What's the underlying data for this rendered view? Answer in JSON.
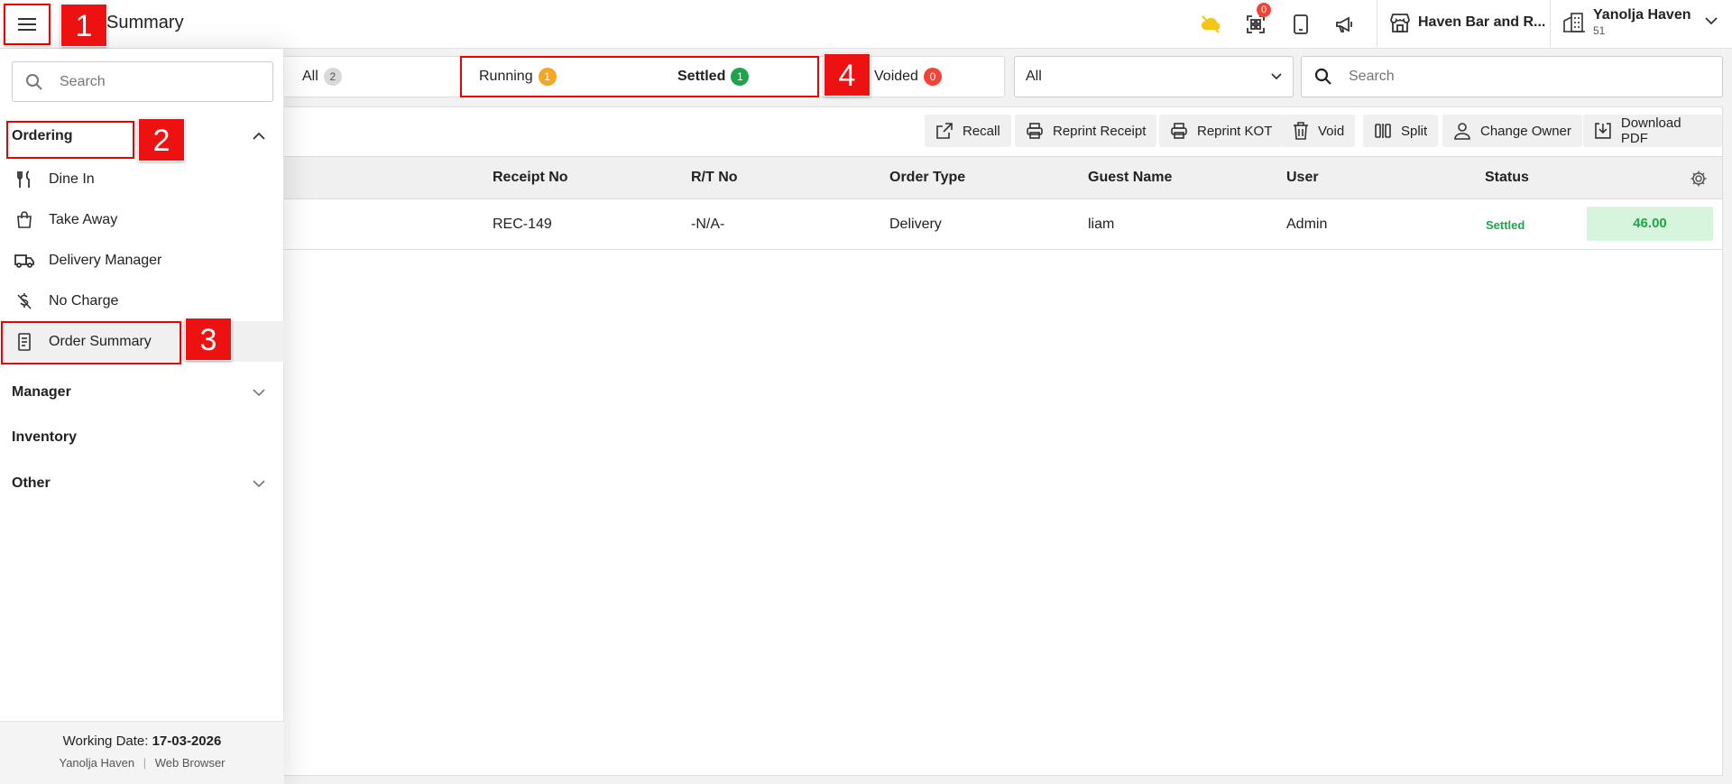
{
  "header": {
    "page_title": "Summary",
    "qr_badge": "0",
    "outlet_name": "Haven Bar and R...",
    "user_name": "Yanolja Haven",
    "user_sub": "51"
  },
  "markers": {
    "m1": "1",
    "m2": "2",
    "m3": "3",
    "m4": "4"
  },
  "sidebar": {
    "search_placeholder": "Search",
    "sections": {
      "ordering": "Ordering",
      "manager": "Manager",
      "inventory": "Inventory",
      "other": "Other"
    },
    "items": [
      {
        "label": "Dine In",
        "icon": "utensils-icon"
      },
      {
        "label": "Take Away",
        "icon": "bag-icon"
      },
      {
        "label": "Delivery Manager",
        "icon": "truck-icon"
      },
      {
        "label": "No Charge",
        "icon": "no-charge-icon"
      },
      {
        "label": "Order Summary",
        "icon": "receipt-icon"
      }
    ],
    "footer": {
      "working_date_label": "Working Date:",
      "working_date": "17-03-2026",
      "property": "Yanolja Haven",
      "separator": "|",
      "client": "Web Browser"
    }
  },
  "tabs": [
    {
      "label": "All",
      "count": "2",
      "color": "#d9d9d9"
    },
    {
      "label": "Running",
      "count": "1",
      "color": "#f5a623"
    },
    {
      "label": "Settled",
      "count": "1",
      "color": "#1ea54a"
    },
    {
      "label": "Voided",
      "count": "0",
      "color": "#f44336"
    }
  ],
  "filter": {
    "selected": "All"
  },
  "search": {
    "placeholder": "Search"
  },
  "actions": [
    {
      "label": "Recall",
      "icon": "external-link-icon"
    },
    {
      "label": "Reprint Receipt",
      "icon": "printer-icon"
    },
    {
      "label": "Reprint KOT",
      "icon": "printer-icon"
    },
    {
      "label": "Void",
      "icon": "trash-icon"
    },
    {
      "label": "Split",
      "icon": "split-icon"
    },
    {
      "label": "Change Owner",
      "icon": "user-icon"
    },
    {
      "label": "Download PDF",
      "icon": "download-icon"
    }
  ],
  "table": {
    "columns": [
      "Receipt No",
      "R/T No",
      "Order Type",
      "Guest Name",
      "User",
      "Status"
    ],
    "rows": [
      {
        "receipt_no": "REC-149",
        "rt_no": "-N/A-",
        "order_type": "Delivery",
        "guest_name": "liam",
        "user": "Admin",
        "status": "Settled",
        "amount": "46.00"
      }
    ]
  }
}
